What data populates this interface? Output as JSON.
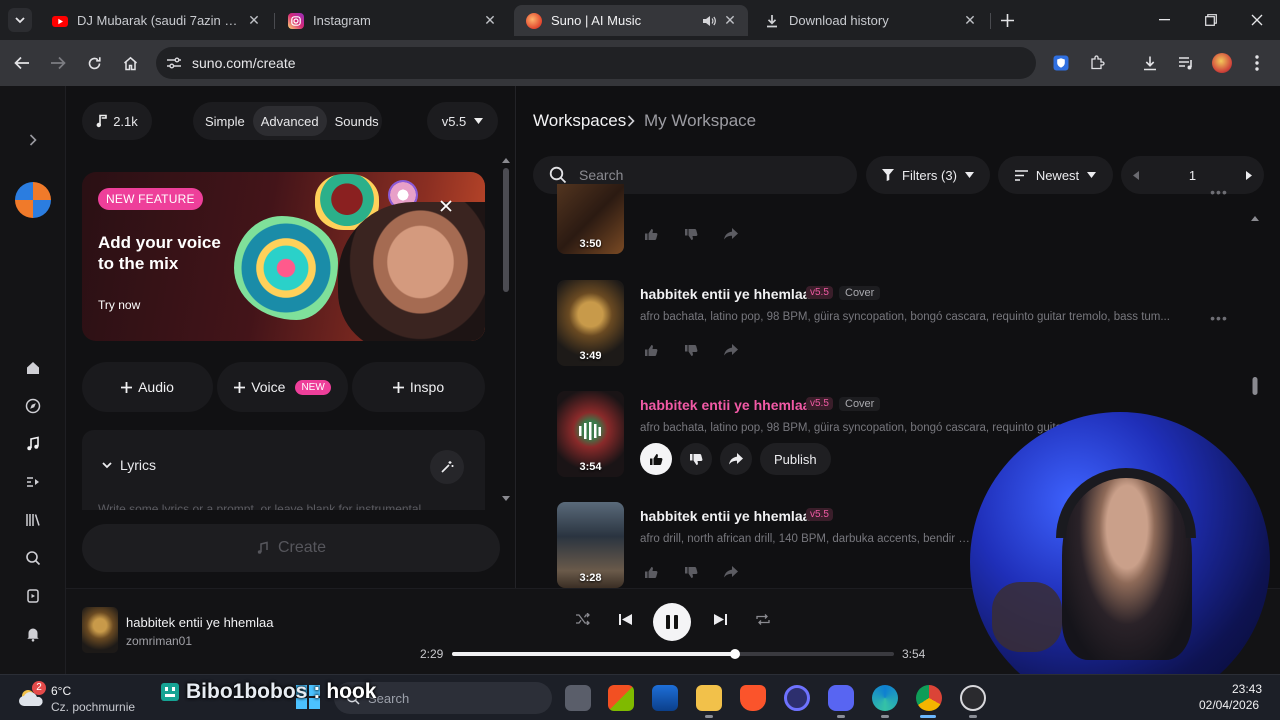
{
  "browser": {
    "tabs": [
      {
        "title": "DJ Mubarak (saudi 7azin elwatani",
        "favicon_color": "#ff0000"
      },
      {
        "title": "Instagram",
        "favicon_color": "#e1306c"
      },
      {
        "title": "Suno | AI Music",
        "favicon_color": "#f26a3a"
      },
      {
        "title": "Download history",
        "favicon_color": "#c9cbd0"
      }
    ],
    "url": "suno.com/create"
  },
  "create": {
    "credits": "2.1k",
    "modes": [
      "Simple",
      "Advanced",
      "Sounds"
    ],
    "active_mode": "Advanced",
    "model": "v5.5",
    "promo": {
      "badge": "NEW FEATURE",
      "headline_1": "Add your voice",
      "headline_2": "to the mix",
      "cta": "Try now"
    },
    "add_buttons": {
      "audio": "Audio",
      "voice": "Voice",
      "voice_badge": "NEW",
      "inspo": "Inspo"
    },
    "lyrics_label": "Lyrics",
    "lyrics_placeholder": "Write some lyrics or a prompt, or leave blank for instrumental",
    "create_button": "Create"
  },
  "workspace": {
    "breadcrumb_root": "Workspaces",
    "breadcrumb_current": "My Workspace",
    "search_placeholder": "Search",
    "filters_label": "Filters (3)",
    "sort_label": "Newest",
    "page": "1",
    "songs": [
      {
        "title": "",
        "version": "",
        "type": "",
        "tags": "",
        "duration": "3:50"
      },
      {
        "title": "habbitek entii ye hhemlaa",
        "version": "v5.5",
        "type": "Cover",
        "tags": "afro bachata, latino pop, 98 BPM, güira syncopation, bongó cascara, requinto guitar tremolo, bass tum...",
        "duration": "3:49"
      },
      {
        "title": "habbitek entii ye hhemlaa",
        "version": "v5.5",
        "type": "Cover",
        "tags": "afro bachata, latino pop, 98 BPM, güira syncopation, bongó cascara, requinto guitar tr...",
        "duration": "3:54",
        "publish": "Publish"
      },
      {
        "title": "habbitek entii ye hhemlaa",
        "version": "v5.5",
        "type": "",
        "tags": "afro drill, north african drill, 140 BPM, darbuka accents, bendir strik...",
        "duration": "3:28"
      }
    ]
  },
  "player": {
    "title": "habbitek entii ye hhemlaa",
    "artist": "zomriman01",
    "elapsed": "2:29",
    "total": "3:54",
    "progress": 0.64
  },
  "overlay": {
    "channel": "Bibo1bobos",
    "sep": ":",
    "message": "hook"
  },
  "taskbar": {
    "temperature": "6°C",
    "weather": "Cz. pochmurnie",
    "weather_badge": "2",
    "search_placeholder": "Search",
    "time": "23:43",
    "date": "02/04/2026"
  },
  "colors": {
    "accent_pink": "#ee3f9a",
    "background": "#101012",
    "panel": "#1c1c1f"
  }
}
